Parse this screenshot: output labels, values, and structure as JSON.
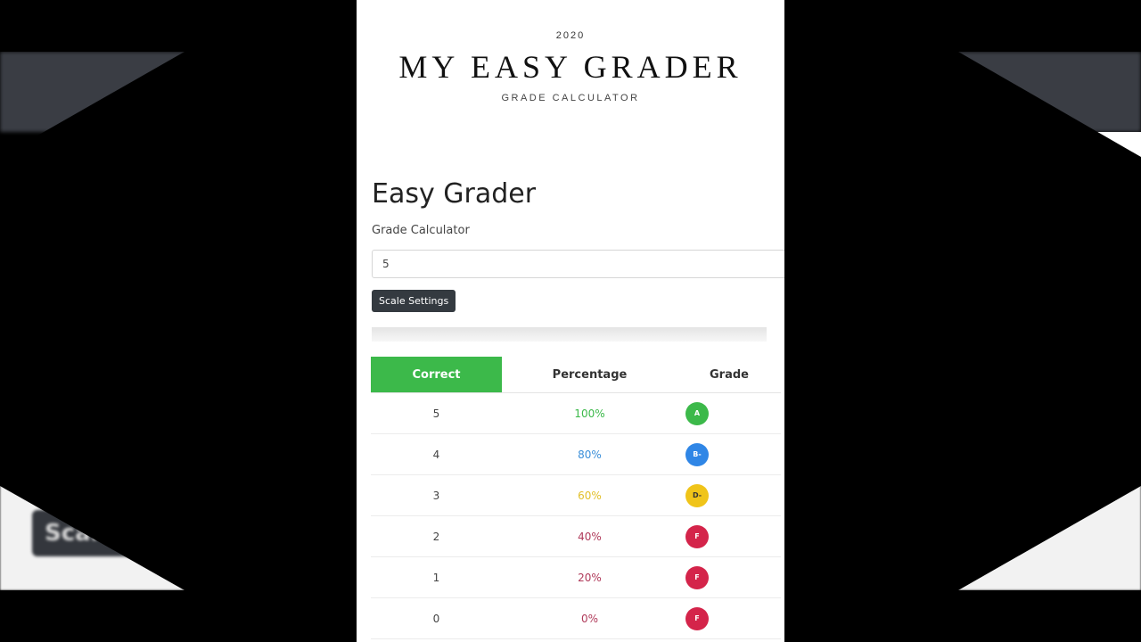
{
  "hero": {
    "year": "2020",
    "title": "MY EASY GRADER",
    "subtitle": "GRADE CALCULATOR"
  },
  "app": {
    "title": "Easy Grader",
    "subtitle": "Grade Calculator",
    "input_value": "5",
    "scale_button": "Scale Settings"
  },
  "table": {
    "headers": {
      "correct": "Correct",
      "percentage": "Percentage",
      "grade": "Grade"
    },
    "rows": [
      {
        "correct": "5",
        "percentage": "100%",
        "grade": "A"
      },
      {
        "correct": "4",
        "percentage": "80%",
        "grade": "B-"
      },
      {
        "correct": "3",
        "percentage": "60%",
        "grade": "D-"
      },
      {
        "correct": "2",
        "percentage": "40%",
        "grade": "F"
      },
      {
        "correct": "1",
        "percentage": "20%",
        "grade": "F"
      },
      {
        "correct": "0",
        "percentage": "0%",
        "grade": "F"
      }
    ]
  },
  "colors": {
    "accent_green": "#3cb94a",
    "grade_A": "#3cb94a",
    "grade_B": "#2f86e6",
    "grade_D": "#f0c419",
    "grade_F": "#d4244a",
    "pct_A": "#3cb94a",
    "pct_B": "#3a8fd9",
    "pct_D": "#e2c02a",
    "pct_F": "#b03a5a",
    "dark_button": "#343a40"
  },
  "background": {
    "ghost_button_text": "Scale"
  }
}
